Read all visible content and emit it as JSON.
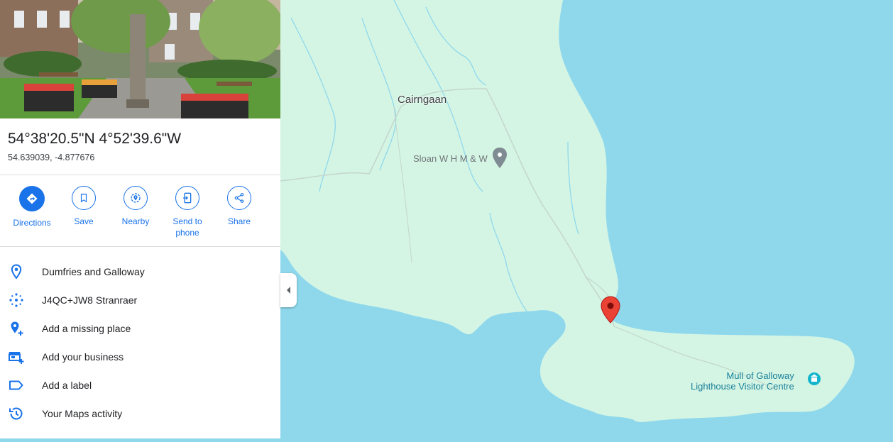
{
  "place": {
    "coordinates_dms": "54°38'20.5\"N 4°52'39.6\"W",
    "coordinates_decimal": "54.639039, -4.877676"
  },
  "actions": [
    {
      "label": "Directions",
      "icon": "directions-icon"
    },
    {
      "label": "Save",
      "icon": "bookmark-icon"
    },
    {
      "label": "Nearby",
      "icon": "nearby-icon"
    },
    {
      "label": "Send to phone",
      "icon": "send-to-phone-icon"
    },
    {
      "label": "Share",
      "icon": "share-icon"
    }
  ],
  "details": [
    {
      "label": "Dumfries and Galloway",
      "icon": "location-pin-icon"
    },
    {
      "label": "J4QC+JW8 Stranraer",
      "icon": "plus-code-icon"
    },
    {
      "label": "Add a missing place",
      "icon": "add-place-icon"
    },
    {
      "label": "Add your business",
      "icon": "add-business-icon"
    },
    {
      "label": "Add a label",
      "icon": "label-icon"
    },
    {
      "label": "Your Maps activity",
      "icon": "history-icon"
    }
  ],
  "map": {
    "labels": {
      "town": "Cairngaan",
      "business": "Sloan W H M & W",
      "poi_line1": "Mull of Galloway",
      "poi_line2": "Lighthouse Visitor Centre"
    },
    "colors": {
      "water": "#8fd8ec",
      "land": "#d4f5e4",
      "accent": "#1a73e8",
      "marker": "#ea4335",
      "poi": "#12b5cb"
    }
  }
}
